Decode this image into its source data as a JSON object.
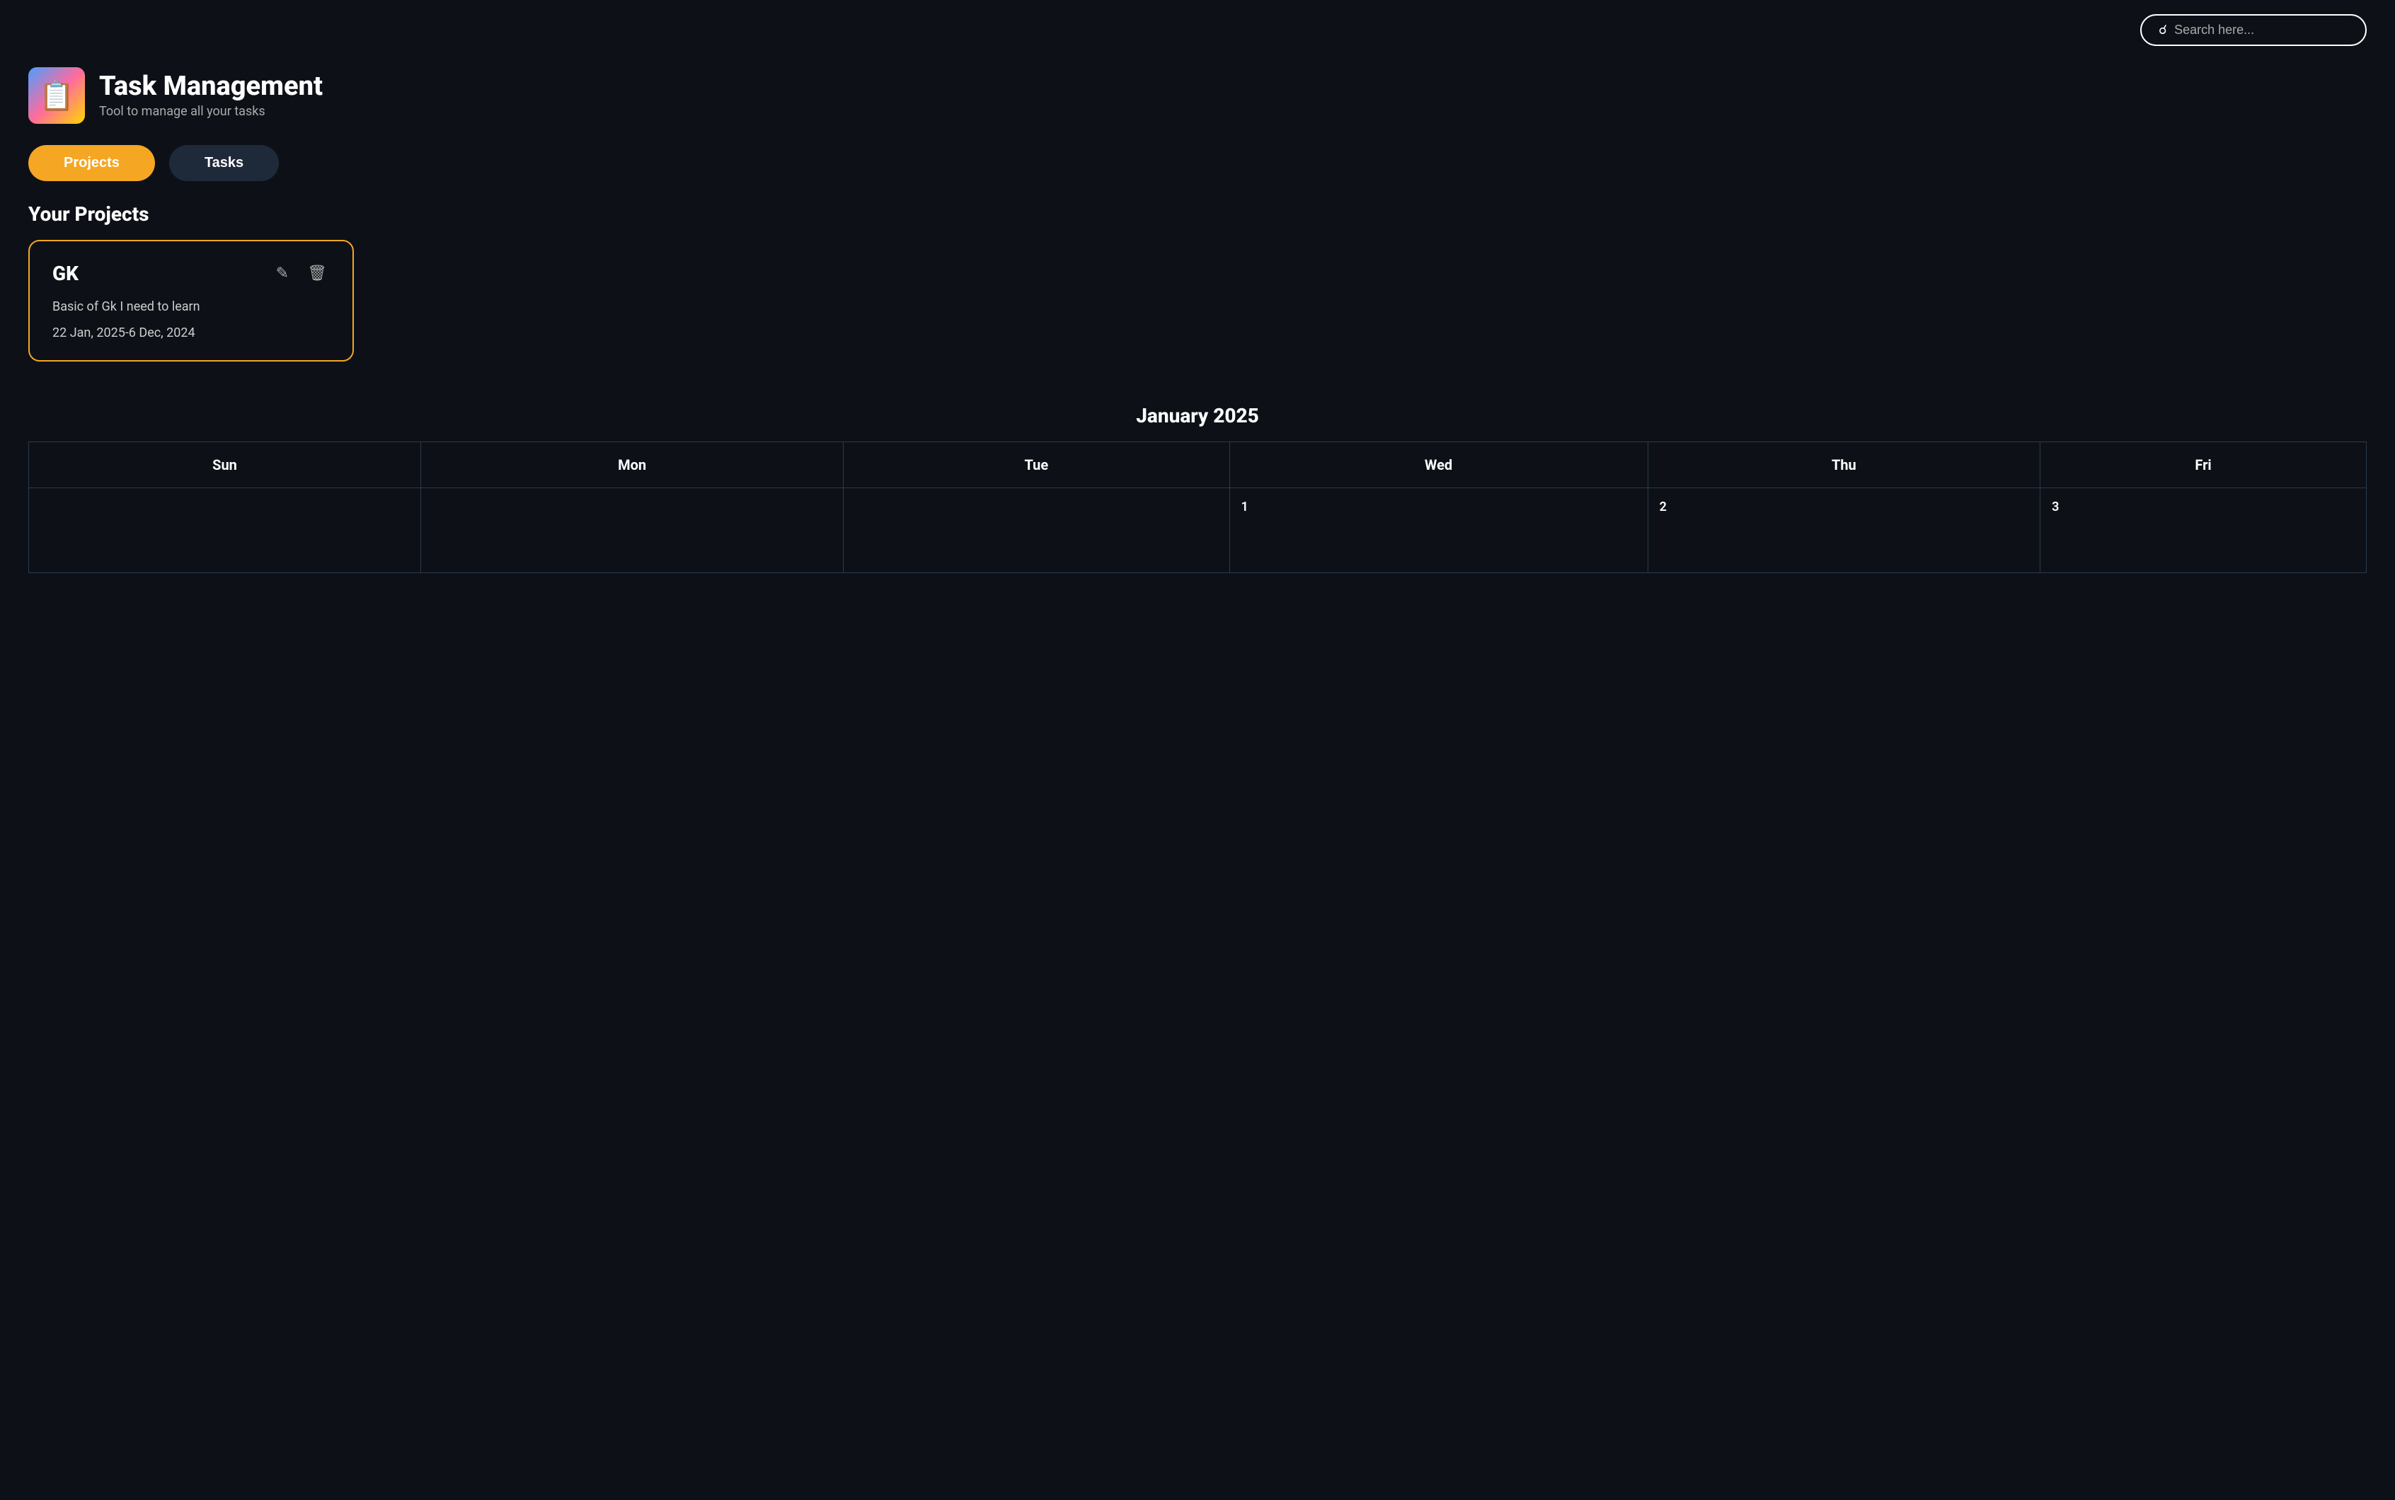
{
  "header": {
    "search_placeholder": "Search here..."
  },
  "app": {
    "title": "Task Management",
    "subtitle": "Tool to manage all your tasks",
    "logo_emoji": "📋"
  },
  "tabs": [
    {
      "id": "projects",
      "label": "Projects",
      "active": true
    },
    {
      "id": "tasks",
      "label": "Tasks",
      "active": false
    }
  ],
  "projects_section": {
    "title": "Your Projects",
    "cards": [
      {
        "name": "GK",
        "description": "Basic of Gk I need to learn",
        "dates": "22 Jan, 2025-6 Dec, 2024"
      }
    ]
  },
  "calendar": {
    "title": "January 2025",
    "days_of_week": [
      "Sun",
      "Mon",
      "Tue",
      "Wed",
      "Thu",
      "Fri"
    ],
    "weeks": [
      [
        {
          "date": "",
          "empty": true
        },
        {
          "date": "",
          "empty": true
        },
        {
          "date": "",
          "empty": true
        },
        {
          "date": "1",
          "empty": false
        },
        {
          "date": "2",
          "empty": false
        },
        {
          "date": "3",
          "empty": false
        }
      ]
    ]
  }
}
